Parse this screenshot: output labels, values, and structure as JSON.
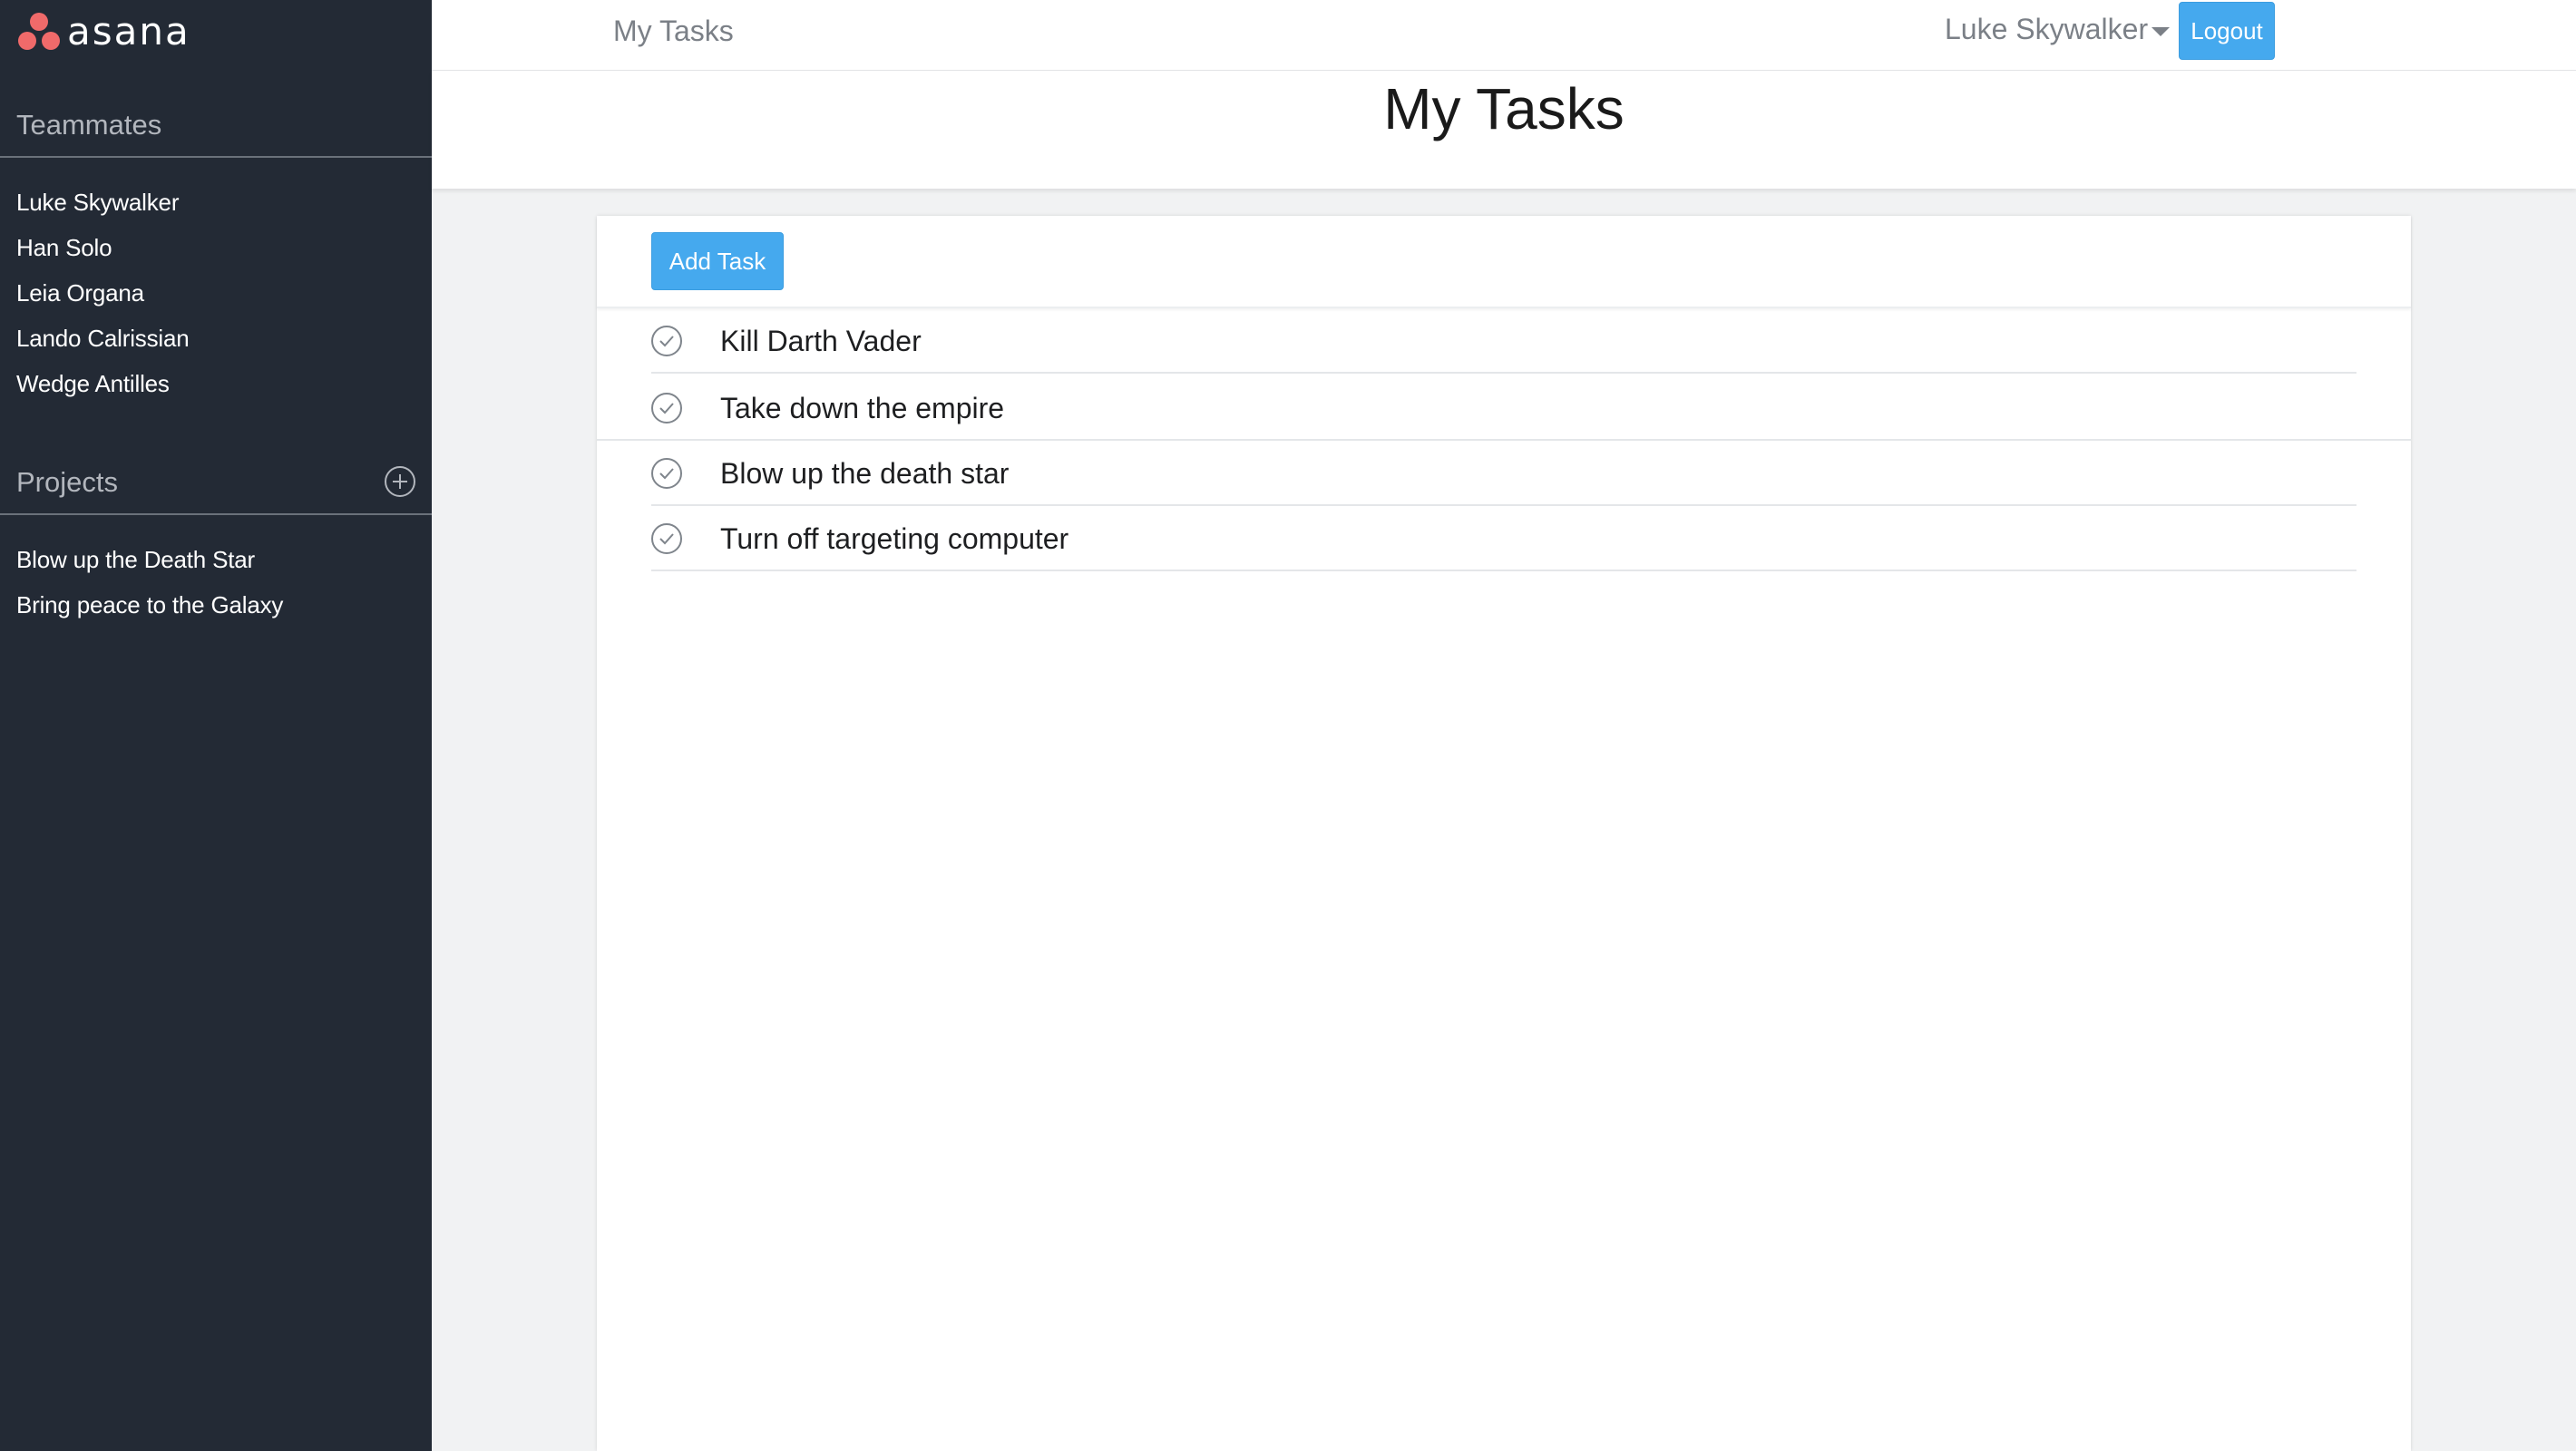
{
  "app": {
    "logo_text": "asana"
  },
  "sidebar": {
    "teammates_title": "Teammates",
    "teammates": [
      "Luke Skywalker",
      "Han Solo",
      "Leia Organa",
      "Lando Calrissian",
      "Wedge Antilles"
    ],
    "projects_title": "Projects",
    "projects": [
      "Blow up the Death Star",
      "Bring peace to the Galaxy"
    ]
  },
  "topbar": {
    "title": "My Tasks",
    "user_name": "Luke Skywalker",
    "logout_label": "Logout"
  },
  "header": {
    "title": "My Tasks"
  },
  "tasks_panel": {
    "add_task_label": "Add Task",
    "tasks": [
      "Kill Darth Vader",
      "Take down the empire",
      "Blow up the death star",
      "Turn off targeting computer"
    ]
  },
  "colors": {
    "sidebar_bg": "#232a35",
    "accent_button": "#45a9ee",
    "logo_dots": "#f06a6a"
  },
  "icons": {
    "logo": "asana-dots-icon",
    "add_project": "plus-circle-icon",
    "task_complete": "check-circle-icon",
    "user_menu": "caret-down-icon"
  }
}
